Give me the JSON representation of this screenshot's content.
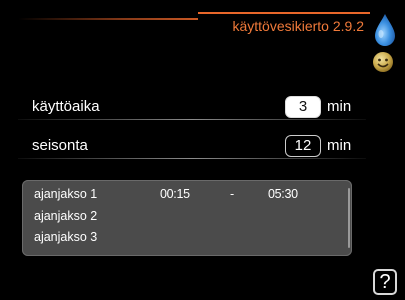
{
  "header": {
    "title": "käyttövesikierto 2.9.2"
  },
  "icons": {
    "status": "water-drop-icon",
    "mode": "smiley-icon",
    "help": "help-icon"
  },
  "settings": [
    {
      "label": "käyttöaika",
      "value": "3",
      "unit": "min",
      "selected": true
    },
    {
      "label": "seisonta",
      "value": "12",
      "unit": "min",
      "selected": false
    }
  ],
  "schedule": [
    {
      "label": "ajanjakso 1",
      "start": "00:15",
      "separator": "-",
      "end": "05:30"
    },
    {
      "label": "ajanjakso 2",
      "start": "",
      "separator": "",
      "end": ""
    },
    {
      "label": "ajanjakso 3",
      "start": "",
      "separator": "",
      "end": ""
    }
  ],
  "help": {
    "label": "?"
  },
  "colors": {
    "accent": "#e8672a",
    "title_text": "#f07a3a",
    "panel": "#4b4b4b",
    "drop": "#2a7fd0"
  }
}
